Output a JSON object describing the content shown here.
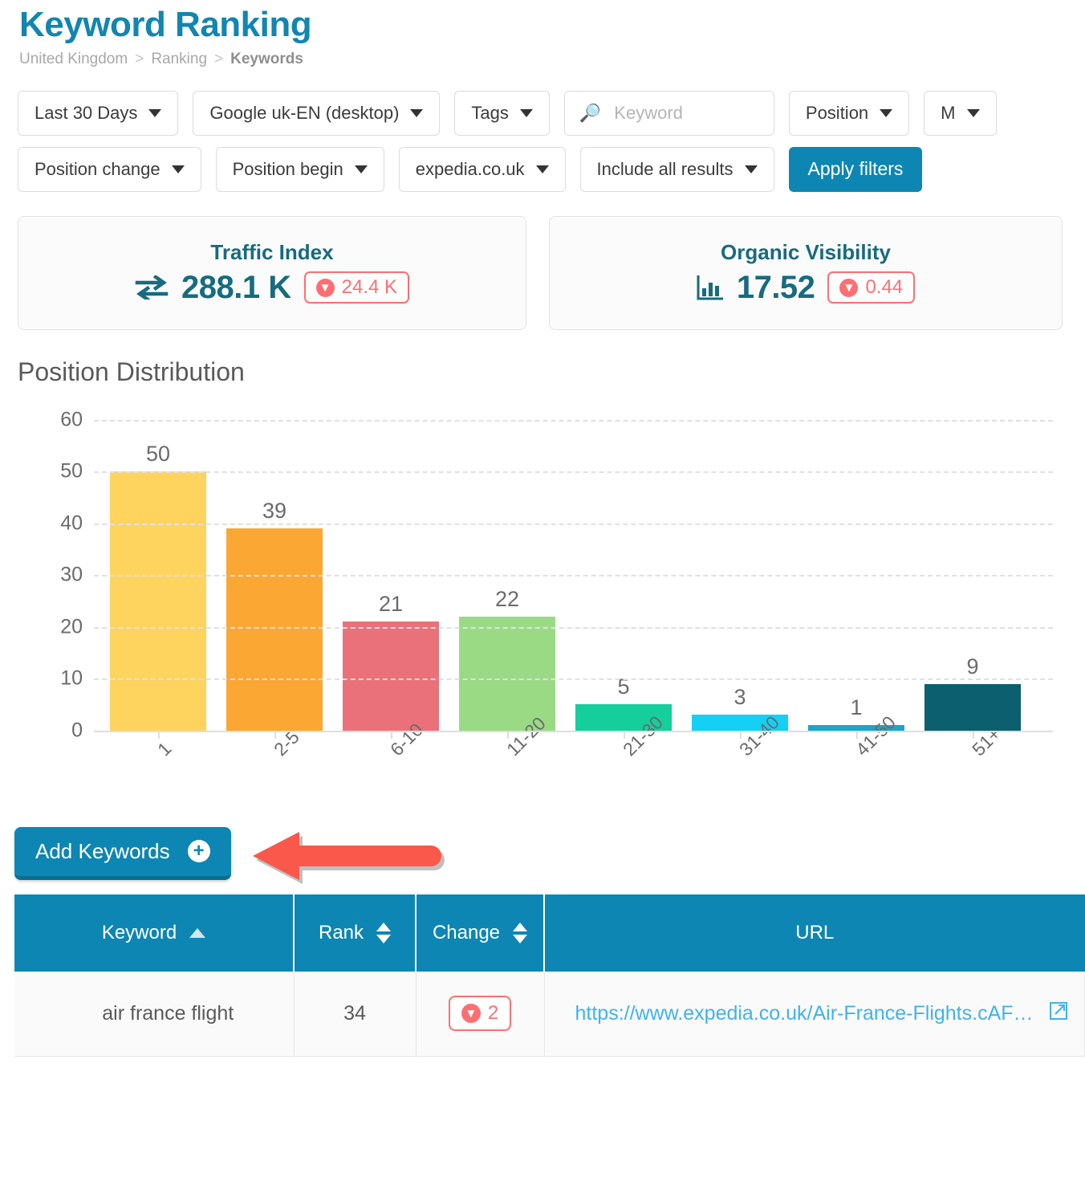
{
  "header": {
    "title": "Keyword Ranking",
    "breadcrumb": [
      {
        "label": "United Kingdom",
        "current": false
      },
      {
        "label": "Ranking",
        "current": false
      },
      {
        "label": "Keywords",
        "current": true
      }
    ],
    "separator": ">"
  },
  "filters": {
    "row1": [
      {
        "label": "Last 30 Days",
        "type": "dropdown"
      },
      {
        "label": "Google uk-EN (desktop)",
        "type": "dropdown"
      },
      {
        "label": "Tags",
        "type": "dropdown"
      },
      {
        "label": "",
        "type": "search",
        "placeholder": "Keyword",
        "icon": "search-icon"
      },
      {
        "label": "Position",
        "type": "dropdown"
      },
      {
        "label": "M",
        "type": "dropdown"
      }
    ],
    "row2": [
      {
        "label": "Position change",
        "type": "dropdown"
      },
      {
        "label": "Position begin",
        "type": "dropdown"
      },
      {
        "label": "expedia.co.uk",
        "type": "dropdown"
      },
      {
        "label": "Include all results",
        "type": "dropdown"
      }
    ],
    "apply_label": "Apply filters"
  },
  "stats": [
    {
      "label": "Traffic Index",
      "value": "288.1 K",
      "icon": "transfer-arrows-icon",
      "delta": {
        "value": "24.4 K",
        "direction": "down",
        "color": "#fc6f72"
      }
    },
    {
      "label": "Organic Visibility",
      "value": "17.52",
      "icon": "bar-chart-icon",
      "delta": {
        "value": "0.44",
        "direction": "down",
        "color": "#fc6f72"
      }
    }
  ],
  "chart_data": {
    "type": "bar",
    "title": "Position Distribution",
    "xlabel": "",
    "ylabel": "",
    "categories": [
      "1",
      "2-5",
      "6-10",
      "11-20",
      "21-30",
      "31-40",
      "41-50",
      "51+"
    ],
    "values": [
      50,
      39,
      21,
      22,
      5,
      3,
      1,
      9
    ],
    "colors": [
      "#ffd45e",
      "#fba733",
      "#ea7179",
      "#9ada85",
      "#14cf9c",
      "#14d0f5",
      "#1ba5c9",
      "#0b5f6e"
    ],
    "ylim": [
      0,
      60
    ],
    "yticks": [
      0,
      10,
      20,
      30,
      40,
      50,
      60
    ],
    "grid": true,
    "legend": "none",
    "data_labels": true
  },
  "cta": {
    "add_keywords_label": "Add Keywords",
    "plus_icon": "plus-circle-icon",
    "annotation": {
      "type": "arrow-left",
      "color": "#f9584a"
    }
  },
  "table": {
    "columns": [
      {
        "label": "Keyword",
        "sort": "asc"
      },
      {
        "label": "Rank",
        "sort": "both"
      },
      {
        "label": "Change",
        "sort": "both"
      },
      {
        "label": "URL",
        "sort": "none"
      }
    ],
    "rows": [
      {
        "keyword": "air france flight",
        "rank": "34",
        "change": {
          "value": "2",
          "direction": "down"
        },
        "url": "https://www.expedia.co.uk/Air-France-Flights.cAF…"
      }
    ]
  }
}
